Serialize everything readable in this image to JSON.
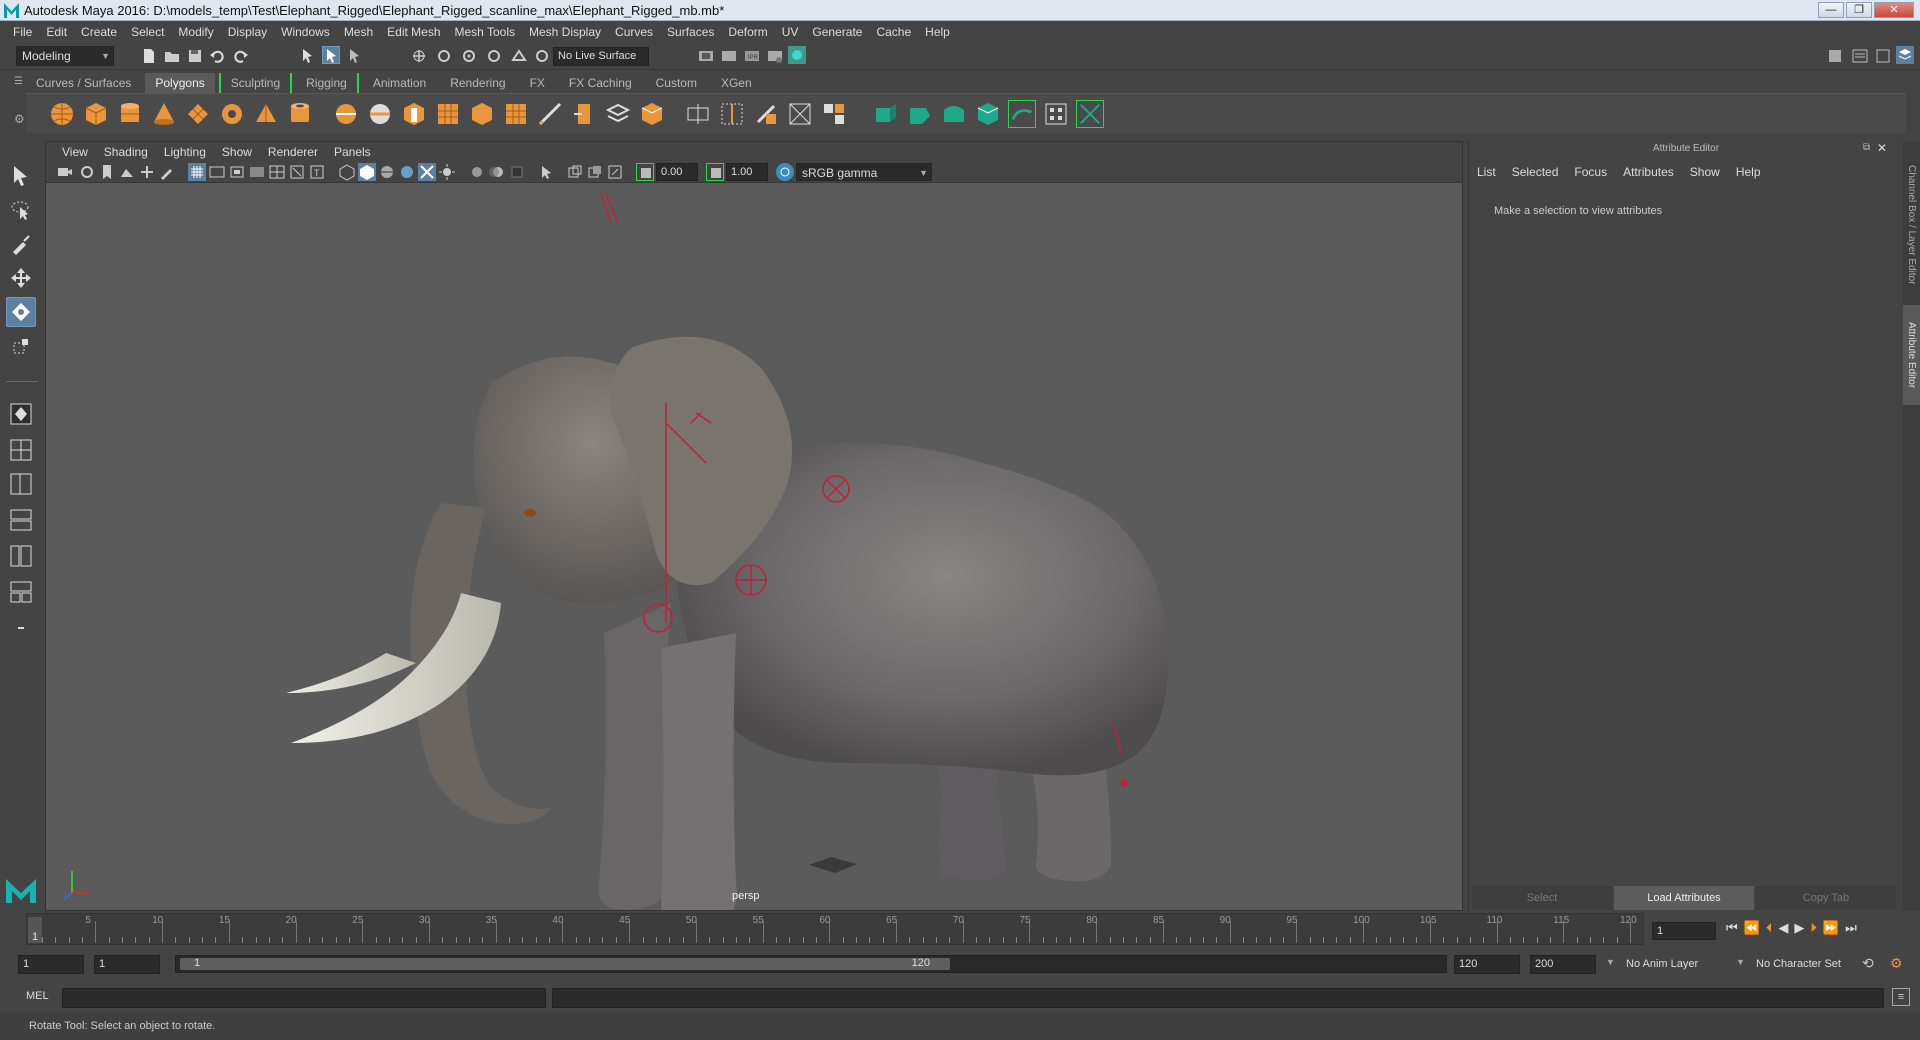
{
  "window": {
    "title": "Autodesk Maya 2016: D:\\models_temp\\Test\\Elephant_Rigged\\Elephant_Rigged_scanline_max\\Elephant_Rigged_mb.mb*"
  },
  "menubar": {
    "items": [
      "File",
      "Edit",
      "Create",
      "Select",
      "Modify",
      "Display",
      "Windows",
      "Mesh",
      "Edit Mesh",
      "Mesh Tools",
      "Mesh Display",
      "Curves",
      "Surfaces",
      "Deform",
      "UV",
      "Generate",
      "Cache",
      "Help"
    ]
  },
  "statusline": {
    "menuset": "Modeling",
    "live_surface": "No Live Surface"
  },
  "shelf": {
    "tabs": [
      "Curves / Surfaces",
      "Polygons",
      "Sculpting",
      "Rigging",
      "Animation",
      "Rendering",
      "FX",
      "FX Caching",
      "Custom",
      "XGen"
    ],
    "active_tab": "Polygons"
  },
  "viewport": {
    "menu": [
      "View",
      "Shading",
      "Lighting",
      "Show",
      "Renderer",
      "Panels"
    ],
    "exposure": "0.00",
    "gamma": "1.00",
    "color_space": "sRGB gamma",
    "camera_label": "persp"
  },
  "attribute_editor": {
    "title": "Attribute Editor",
    "menu": [
      "List",
      "Selected",
      "Focus",
      "Attributes",
      "Show",
      "Help"
    ],
    "message": "Make a selection to view attributes",
    "buttons": {
      "select": "Select",
      "load": "Load Attributes",
      "copy_tab": "Copy Tab"
    }
  },
  "side_tabs": [
    "Channel Box / Layer Editor",
    "Attribute Editor"
  ],
  "timeline": {
    "tick_labels": [
      "5",
      "10",
      "15",
      "20",
      "25",
      "30",
      "35",
      "40",
      "45",
      "50",
      "55",
      "60",
      "65",
      "70",
      "75",
      "80",
      "85",
      "90",
      "95",
      "100",
      "105",
      "110",
      "115",
      "120"
    ],
    "current_frame": "1",
    "current_frame_field": "1"
  },
  "range": {
    "start": "1",
    "start_inner": "1",
    "slider_start": "1",
    "slider_end": "120",
    "end_inner": "120",
    "end": "200",
    "anim_layer": "No Anim Layer",
    "character_set": "No Character Set"
  },
  "command_line": {
    "label": "MEL"
  },
  "help_line": {
    "text": "Rotate Tool: Select an object to rotate."
  },
  "colors": {
    "accent_blue": "#5d7fa0",
    "shelf_green": "#2ad64a",
    "rig_red": "#c0203a",
    "poly_orange": "#e8963c",
    "rig_teal": "#1fa88a"
  }
}
